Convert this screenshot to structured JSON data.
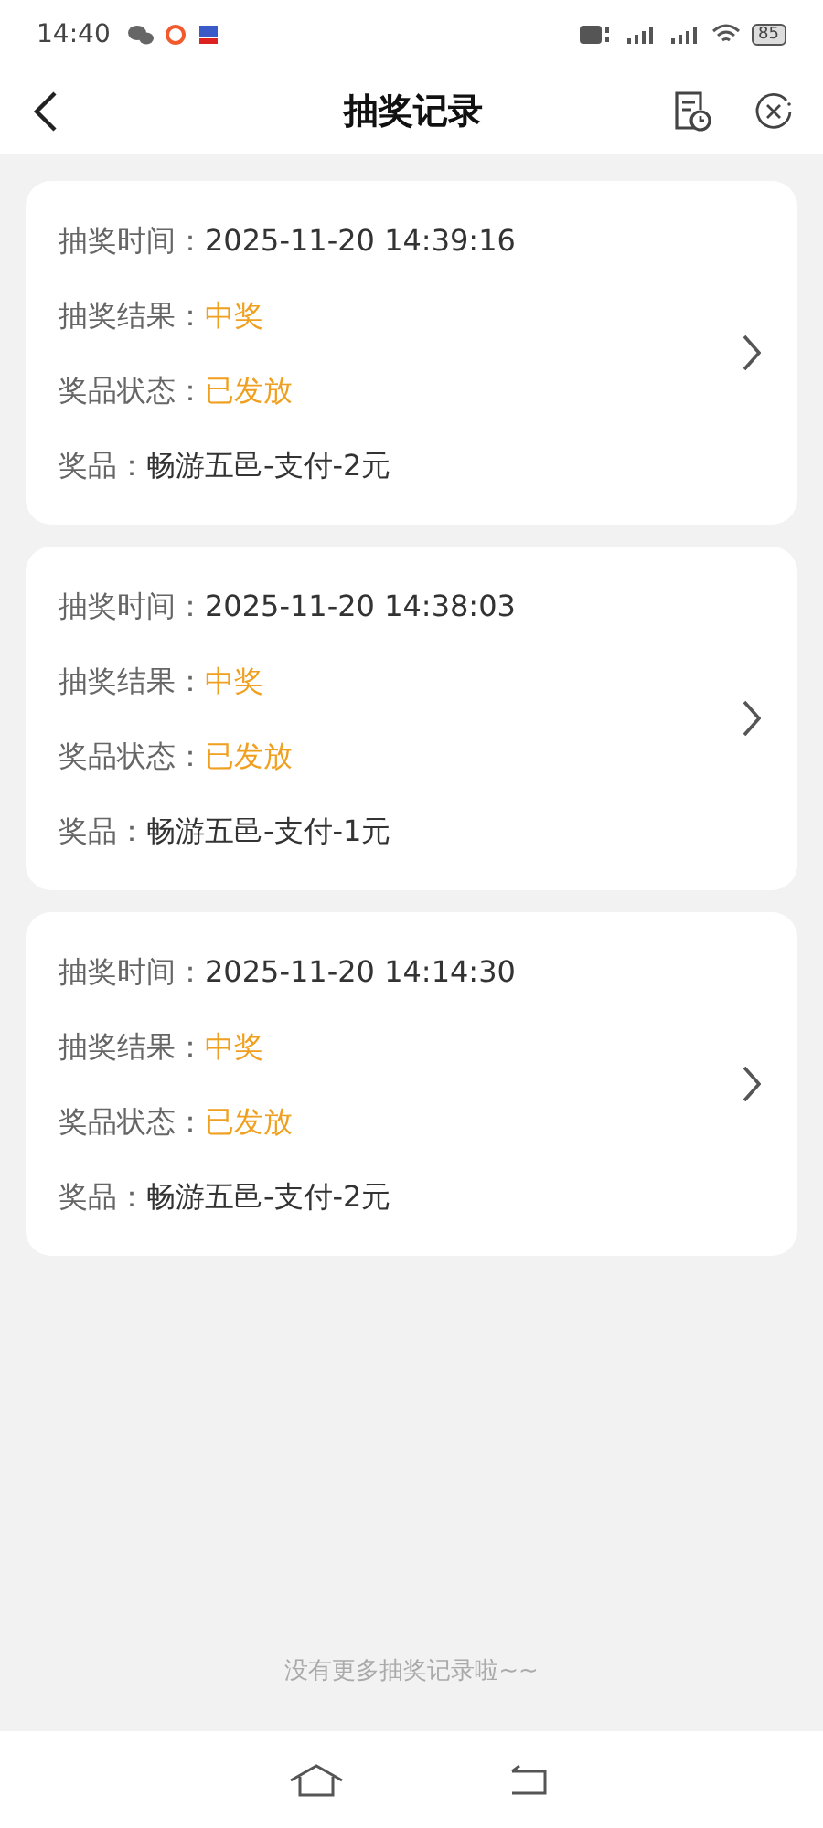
{
  "status_bar": {
    "time": "14:40",
    "battery": "85"
  },
  "header": {
    "title": "抽奖记录"
  },
  "records": [
    {
      "fields": [
        {
          "label": "抽奖时间：",
          "value": "2025-11-20 14:39:16",
          "kind": "plain"
        },
        {
          "label": "抽奖结果：",
          "value": "中奖",
          "kind": "highlight"
        },
        {
          "label": "奖品状态：",
          "value": "已发放",
          "kind": "highlight"
        },
        {
          "label": "奖品：",
          "value": "畅游五邑-支付-2元",
          "kind": "plain"
        }
      ]
    },
    {
      "fields": [
        {
          "label": "抽奖时间：",
          "value": "2025-11-20 14:38:03",
          "kind": "plain"
        },
        {
          "label": "抽奖结果：",
          "value": "中奖",
          "kind": "highlight"
        },
        {
          "label": "奖品状态：",
          "value": "已发放",
          "kind": "highlight"
        },
        {
          "label": "奖品：",
          "value": "畅游五邑-支付-1元",
          "kind": "plain"
        }
      ]
    },
    {
      "fields": [
        {
          "label": "抽奖时间：",
          "value": "2025-11-20 14:14:30",
          "kind": "plain"
        },
        {
          "label": "抽奖结果：",
          "value": "中奖",
          "kind": "highlight"
        },
        {
          "label": "奖品状态：",
          "value": "已发放",
          "kind": "highlight"
        },
        {
          "label": "奖品：",
          "value": "畅游五邑-支付-2元",
          "kind": "plain"
        }
      ]
    }
  ],
  "footer_note": "没有更多抽奖记录啦~~"
}
